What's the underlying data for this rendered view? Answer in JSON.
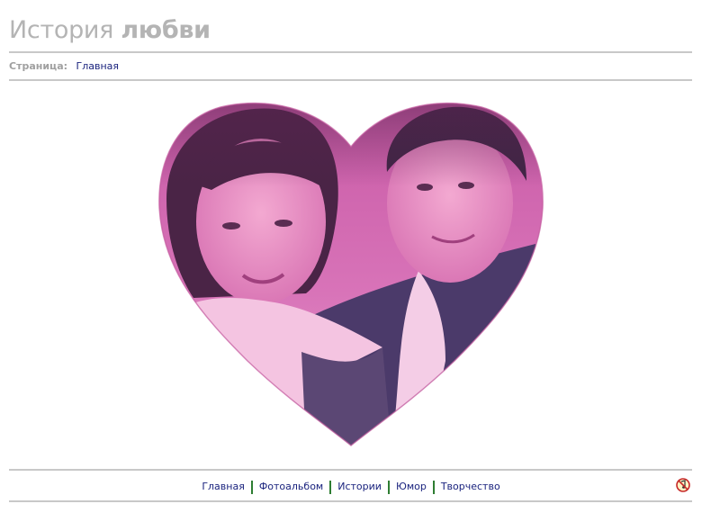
{
  "header": {
    "title_light": "История",
    "title_bold": "любви"
  },
  "breadcrumb": {
    "label": "Страница:",
    "current": "Главная"
  },
  "hero": {
    "image_desc": "heart-shaped-couple-photo",
    "tint_color": "#d65aa8"
  },
  "footer": {
    "nav": [
      {
        "label": "Главная"
      },
      {
        "label": "Фотоальбом"
      },
      {
        "label": "Истории"
      },
      {
        "label": "Юмор"
      },
      {
        "label": "Творчество"
      }
    ],
    "separator_color": "#2e7d32",
    "icon": "no-music-icon"
  },
  "colors": {
    "title": "#b4b4b4",
    "link": "#1a237e",
    "rule": "#c8c8c8"
  }
}
